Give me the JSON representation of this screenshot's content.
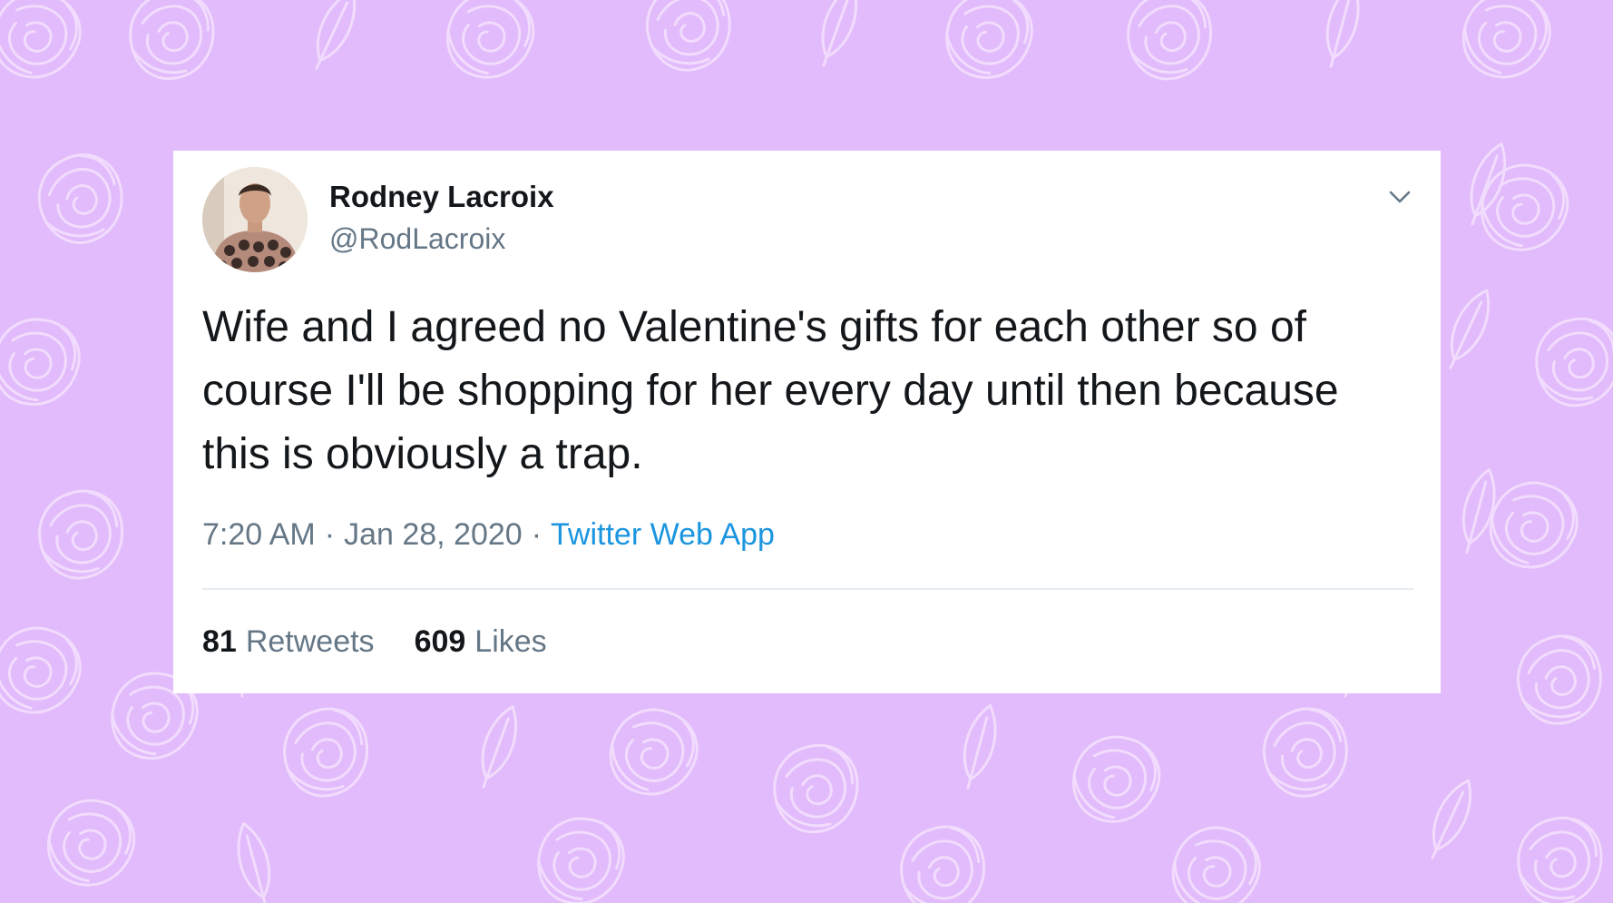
{
  "colors": {
    "background": "#e1bbfb",
    "pattern_line": "#f2dcfd",
    "card": "#ffffff",
    "text_primary": "#14171a",
    "text_secondary": "#657786",
    "link": "#1b95e0",
    "divider": "#e6ecf0"
  },
  "tweet": {
    "author": {
      "display_name": "Rodney Lacroix",
      "handle": "@RodLacroix"
    },
    "text": "Wife and I agreed no Valentine's gifts for each other so of course I'll be shopping for her every day until then because this is obviously a trap.",
    "time": "7:20 AM",
    "separator": "·",
    "date": "Jan 28, 2020",
    "source": "Twitter Web App",
    "retweets": {
      "count": "81",
      "label": "Retweets"
    },
    "likes": {
      "count": "609",
      "label": "Likes"
    }
  },
  "icons": {
    "menu": "chevron-down-icon",
    "pattern": [
      "rose-icon",
      "leaf-icon"
    ]
  }
}
